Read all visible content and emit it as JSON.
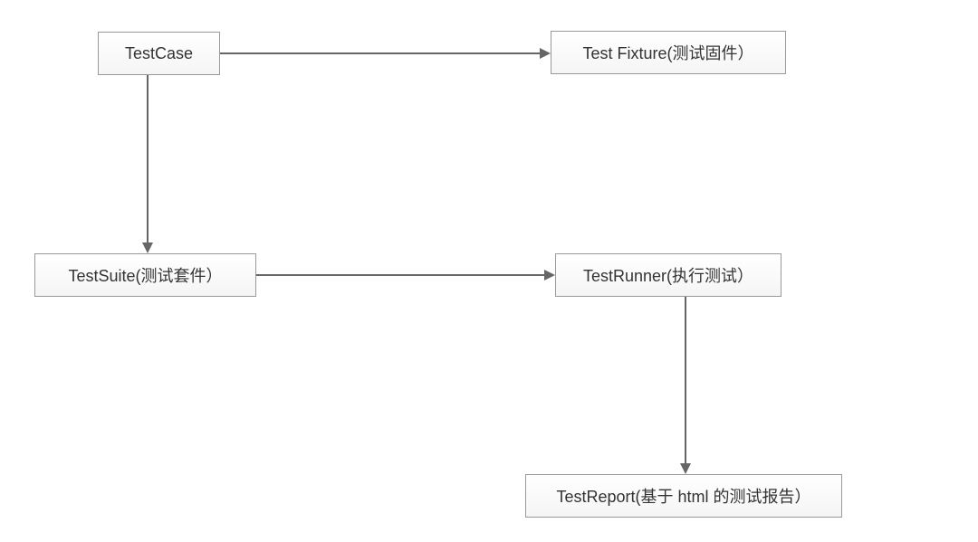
{
  "nodes": {
    "testcase": "TestCase",
    "testfixture": "Test Fixture(测试固件）",
    "testsuite": "TestSuite(测试套件）",
    "testrunner": "TestRunner(执行测试）",
    "testreport": "TestReport(基于 html 的测试报告）"
  }
}
